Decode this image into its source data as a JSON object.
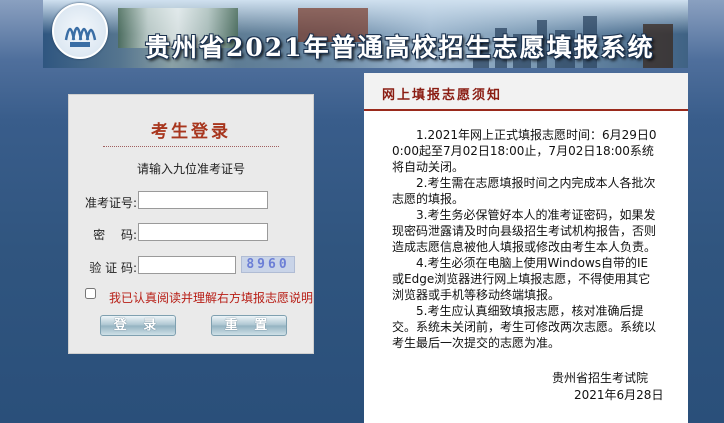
{
  "banner": {
    "title": "贵州省2021年普通高校招生志愿填报系统",
    "logo_icon": "provincial-exam-logo"
  },
  "login": {
    "title": "考生登录",
    "hint": "请输入九位准考证号",
    "fields": {
      "exam_id_label": "准考证号:",
      "exam_id_value": "",
      "password_label": "密　 码:",
      "password_value": "",
      "captcha_label": "验 证 码:",
      "captcha_value": ""
    },
    "captcha_text": "8960",
    "agree_label": "我已认真阅读并理解右方填报志愿说明",
    "agree_checked": false,
    "login_button": "登 录",
    "reset_button": "重 置"
  },
  "notice": {
    "title": "网上填报志愿须知",
    "items": [
      "1.2021年网上正式填报志愿时间：6月29日00:00起至7月02日18:00止，7月02日18:00系统将自动关闭。",
      "2.考生需在志愿填报时间之内完成本人各批次志愿的填报。",
      "3.考生务必保管好本人的准考证密码，如果发现密码泄露请及时向县级招生考试机构报告，否则造成志愿信息被他人填报或修改由考生本人负责。",
      "4.考生必须在电脑上使用Windows自带的IE或Edge浏览器进行网上填报志愿，不得使用其它浏览器或手机等移动终端填报。",
      "5.考生应认真细致填报志愿，核对准确后提交。系统未关闭前，考生可修改两次志愿。系统以考生最后一次提交的志愿为准。"
    ],
    "issuer": "贵州省招生考试院",
    "date": "2021年6月28日"
  },
  "colors": {
    "accent_red": "#a8361e",
    "notice_red": "#8a1c12",
    "agree_red": "#b81e16",
    "background_blue": "#30557f"
  }
}
